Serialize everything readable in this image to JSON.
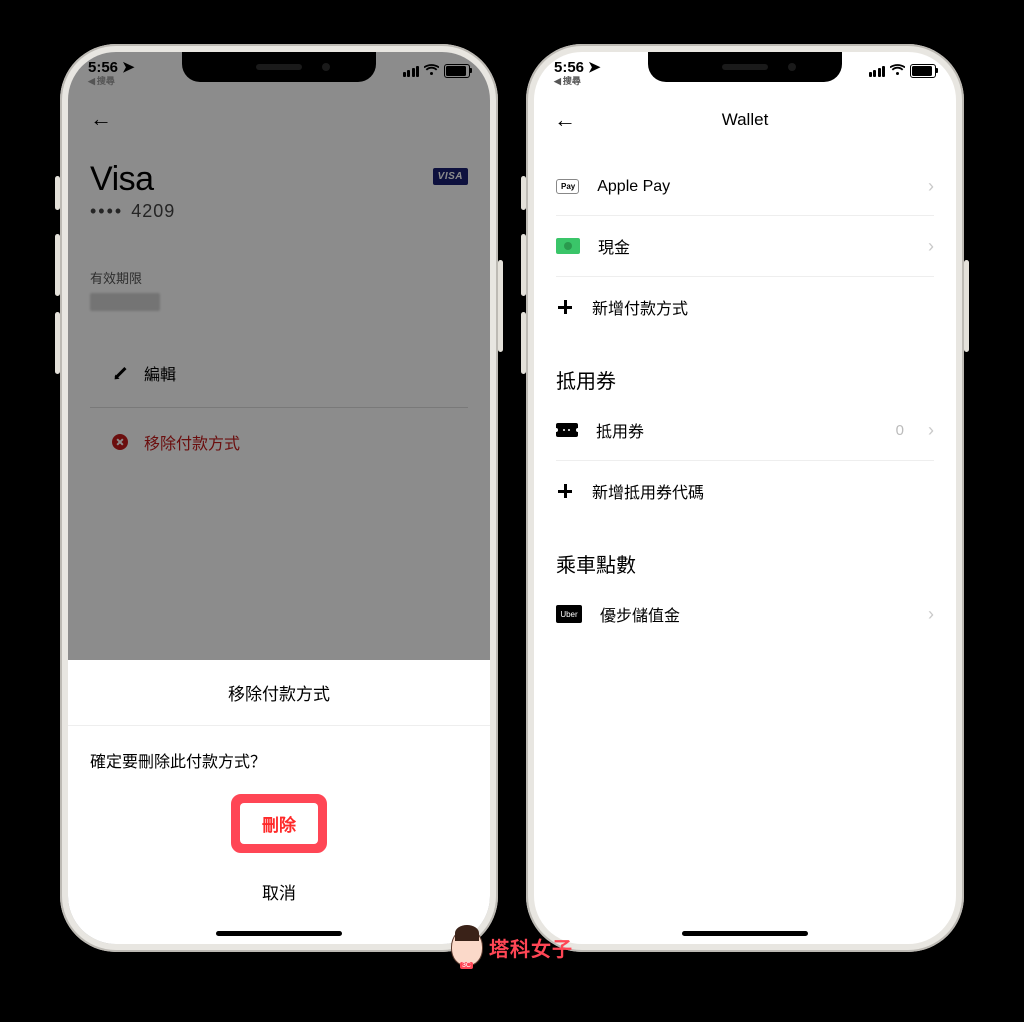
{
  "status": {
    "time": "5:56",
    "back_search": "搜尋"
  },
  "left": {
    "card_brand": "Visa",
    "card_logo_text": "VISA",
    "masked_dots": "••••",
    "last4": "4209",
    "expiry_label": "有效期限",
    "edit_label": "編輯",
    "remove_label": "移除付款方式",
    "sheet": {
      "title": "移除付款方式",
      "message": "確定要刪除此付款方式？",
      "delete": "刪除",
      "cancel": "取消"
    }
  },
  "right": {
    "header": "Wallet",
    "items": {
      "apple_pay": "Apple Pay",
      "cash": "現金",
      "add_payment": "新增付款方式"
    },
    "voucher_section": "抵用券",
    "voucher_row": "抵用券",
    "voucher_count": "0",
    "add_voucher": "新增抵用券代碼",
    "points_section": "乘車點數",
    "uber_credit": "優步儲值金",
    "uber_icon_text": "Uber"
  },
  "watermark": "塔科女子"
}
